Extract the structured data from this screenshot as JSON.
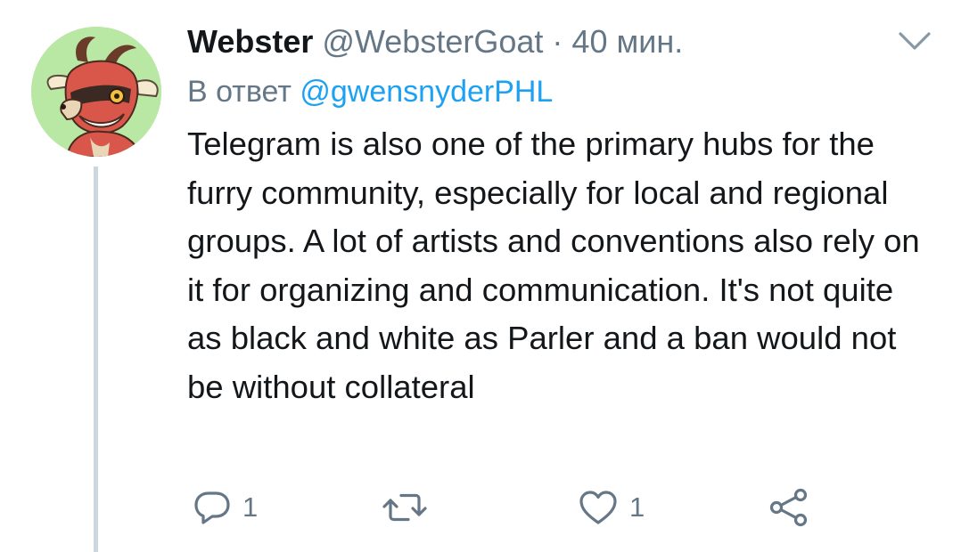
{
  "tweet": {
    "author_name": "Webster",
    "author_handle": "@WebsterGoat",
    "separator": "·",
    "time": "40 мин.",
    "reply_prefix": "В ответ",
    "reply_mention": "@gwensnyderPHL",
    "text": "Telegram is also one of the primary hubs for the furry community, especially for local and regional groups. A lot of artists and conventions also rely on it for organizing and communication. It's not quite as black and white as Parler and a ban would not be without collateral"
  },
  "actions": {
    "reply_count": "1",
    "retweet_count": "",
    "like_count": "1"
  },
  "icons": {
    "reply": "reply-bubble-icon",
    "retweet": "retweet-icon",
    "like": "heart-icon",
    "share": "share-icon",
    "menu": "chevron-down-icon"
  },
  "colors": {
    "text": "#14171a",
    "secondary": "#657786",
    "link": "#1da1f2",
    "thread_line": "#ccd6dd",
    "avatar_bg": "#b9e7a4"
  }
}
